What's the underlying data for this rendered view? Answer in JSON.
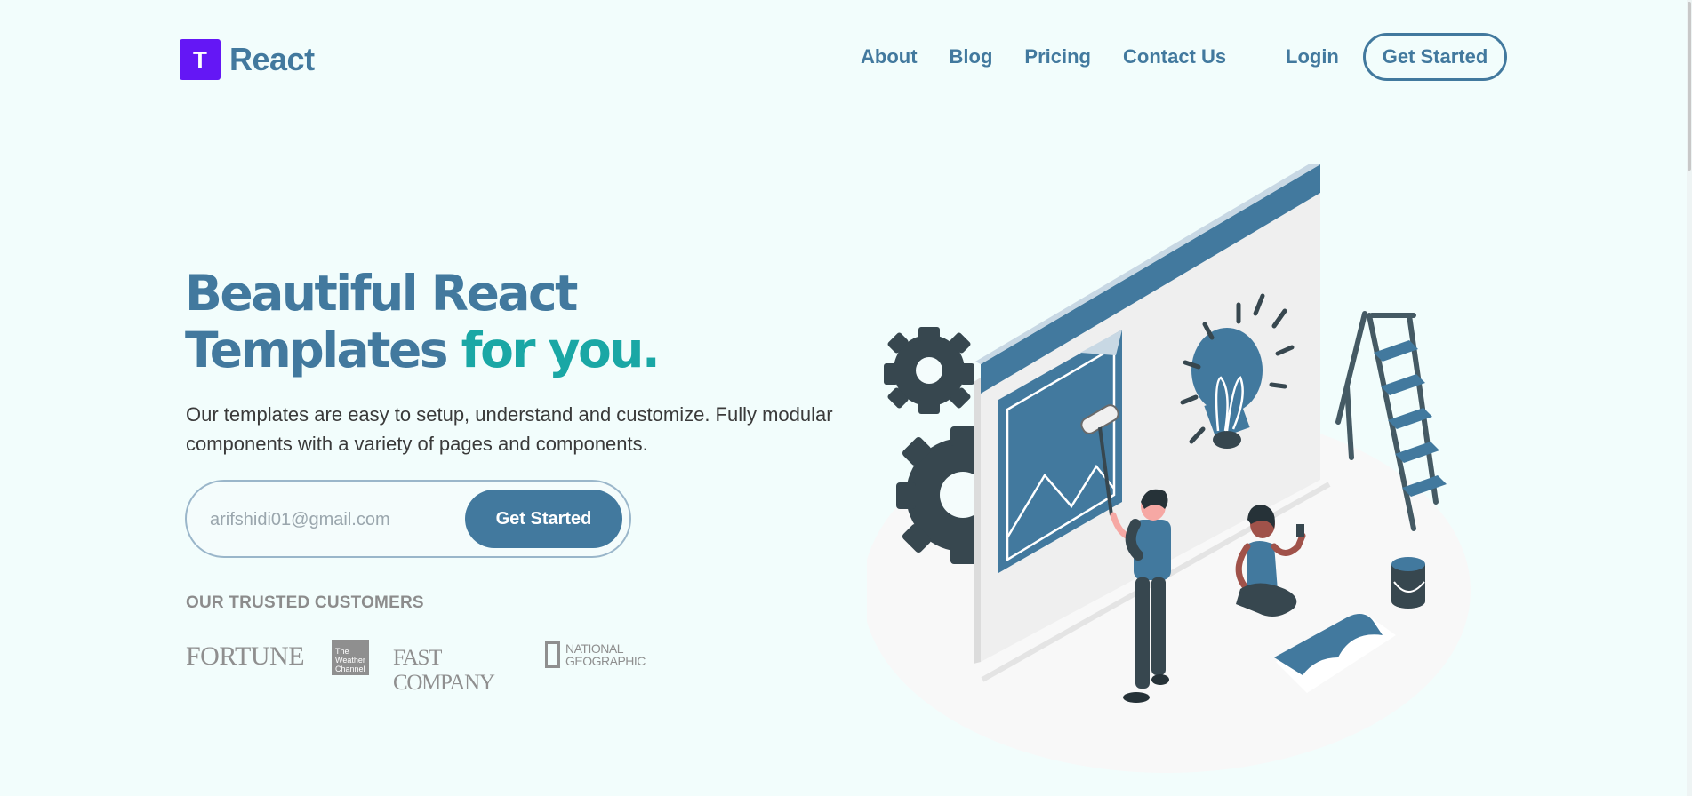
{
  "brand": {
    "logo_letter": "T",
    "name": "React"
  },
  "nav": {
    "items": [
      "About",
      "Blog",
      "Pricing",
      "Contact Us"
    ],
    "login": "Login",
    "cta": "Get Started"
  },
  "hero": {
    "headline_line1": "Beautiful React",
    "headline_line2_main": "Templates ",
    "headline_line2_accent": "for you.",
    "subtext": "Our templates are easy to setup, understand and customize. Fully modular components with a variety of pages and components.",
    "email_value": "arifshidi01@gmail.com",
    "signup_button": "Get Started"
  },
  "customers": {
    "heading": "OUR TRUSTED CUSTOMERS",
    "logos": {
      "fortune": "FORTUNE",
      "weather_channel": [
        "The",
        "Weather",
        "Channel"
      ],
      "fast_company": "FAST COMPANY",
      "national_geographic": [
        "NATIONAL",
        "GEOGRAPHIC"
      ]
    }
  },
  "colors": {
    "background": "#f2fdfc",
    "primary": "#42799e",
    "accent": "#1aa7a5",
    "logo": "#6417f5"
  },
  "illustration": {
    "icon": "painting-website-illustration"
  }
}
